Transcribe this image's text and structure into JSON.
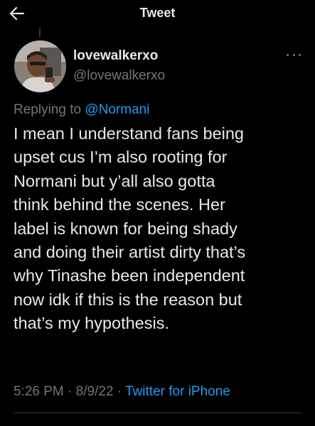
{
  "header": {
    "title": "Tweet",
    "back_icon": "arrow-left-icon"
  },
  "tweet": {
    "author": {
      "display_name": "lovewalkerxo",
      "handle": "@lovewalkerxo"
    },
    "reply": {
      "prefix": "Replying to ",
      "to": "@Normani"
    },
    "text": "I mean I understand fans being\nupset cus I’m also rooting for\nNormani but y’all also gotta\nthink behind the scenes. Her\nlabel is known for being shady\nand doing their artist dirty that’s\nwhy Tinashe been independent\nnow idk if this is the reason but\nthat’s my hypothesis.",
    "time": "5:26 PM",
    "sep1": " · ",
    "date": "8/9/22",
    "sep2": " · ",
    "source": "Twitter for iPhone",
    "more_icon": "more-horizontal-icon"
  },
  "colors": {
    "background": "#000000",
    "text": "#e7e9ea",
    "secondary": "#71767b",
    "accent": "#1d9bf0"
  }
}
